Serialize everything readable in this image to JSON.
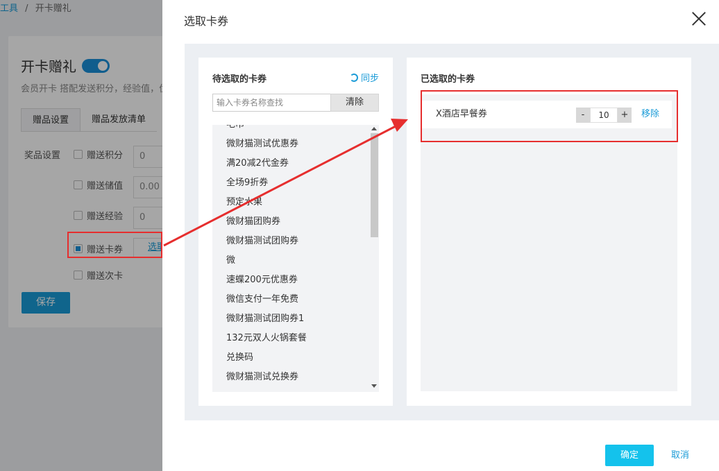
{
  "background": {
    "breadcrumb_prev": "工具",
    "breadcrumb_sep": "/",
    "breadcrumb_current": "开卡赠礼",
    "title": "开卡赠礼",
    "description": "会员开卡 搭配发送积分，经验值，优",
    "tabs": [
      {
        "label": "赠品设置"
      },
      {
        "label": "赠品发放清单"
      }
    ],
    "prize_label": "奖品设置",
    "options": [
      {
        "label": "赠送积分",
        "value": "0"
      },
      {
        "label": "赠送储值",
        "value": "0.00"
      },
      {
        "label": "赠送经验",
        "value": "0"
      },
      {
        "label": "赠送卡券",
        "button": "选取"
      },
      {
        "label": "赠送次卡"
      }
    ],
    "save_label": "保存"
  },
  "drawer": {
    "title": "选取卡券",
    "left_panel": {
      "title": "待选取的卡券",
      "sync_label": "同步",
      "search_placeholder": "输入卡券名称查找",
      "clear_label": "清除",
      "items": [
        "毛巾",
        "微财猫测试优惠券",
        "满20减2代金券",
        "全场9折券",
        "预定水果",
        "微财猫团购券",
        "微财猫测试团购券",
        "微",
        "速蝶200元优惠券",
        "微信支付一年免费",
        "微财猫测试团购券1",
        "132元双人火锅套餐",
        "兑换码",
        "微财猫测试兑换券"
      ]
    },
    "right_panel": {
      "title": "已选取的卡券",
      "selected": [
        {
          "name": "X酒店早餐券",
          "minus": "-",
          "quantity": "10",
          "plus": "+",
          "remove_label": "移除"
        }
      ]
    },
    "ok_label": "确定",
    "cancel_label": "取消"
  },
  "colors": {
    "accent": "#1a9bd7",
    "confirm": "#14c2ec",
    "highlight": "#e62e2e"
  }
}
